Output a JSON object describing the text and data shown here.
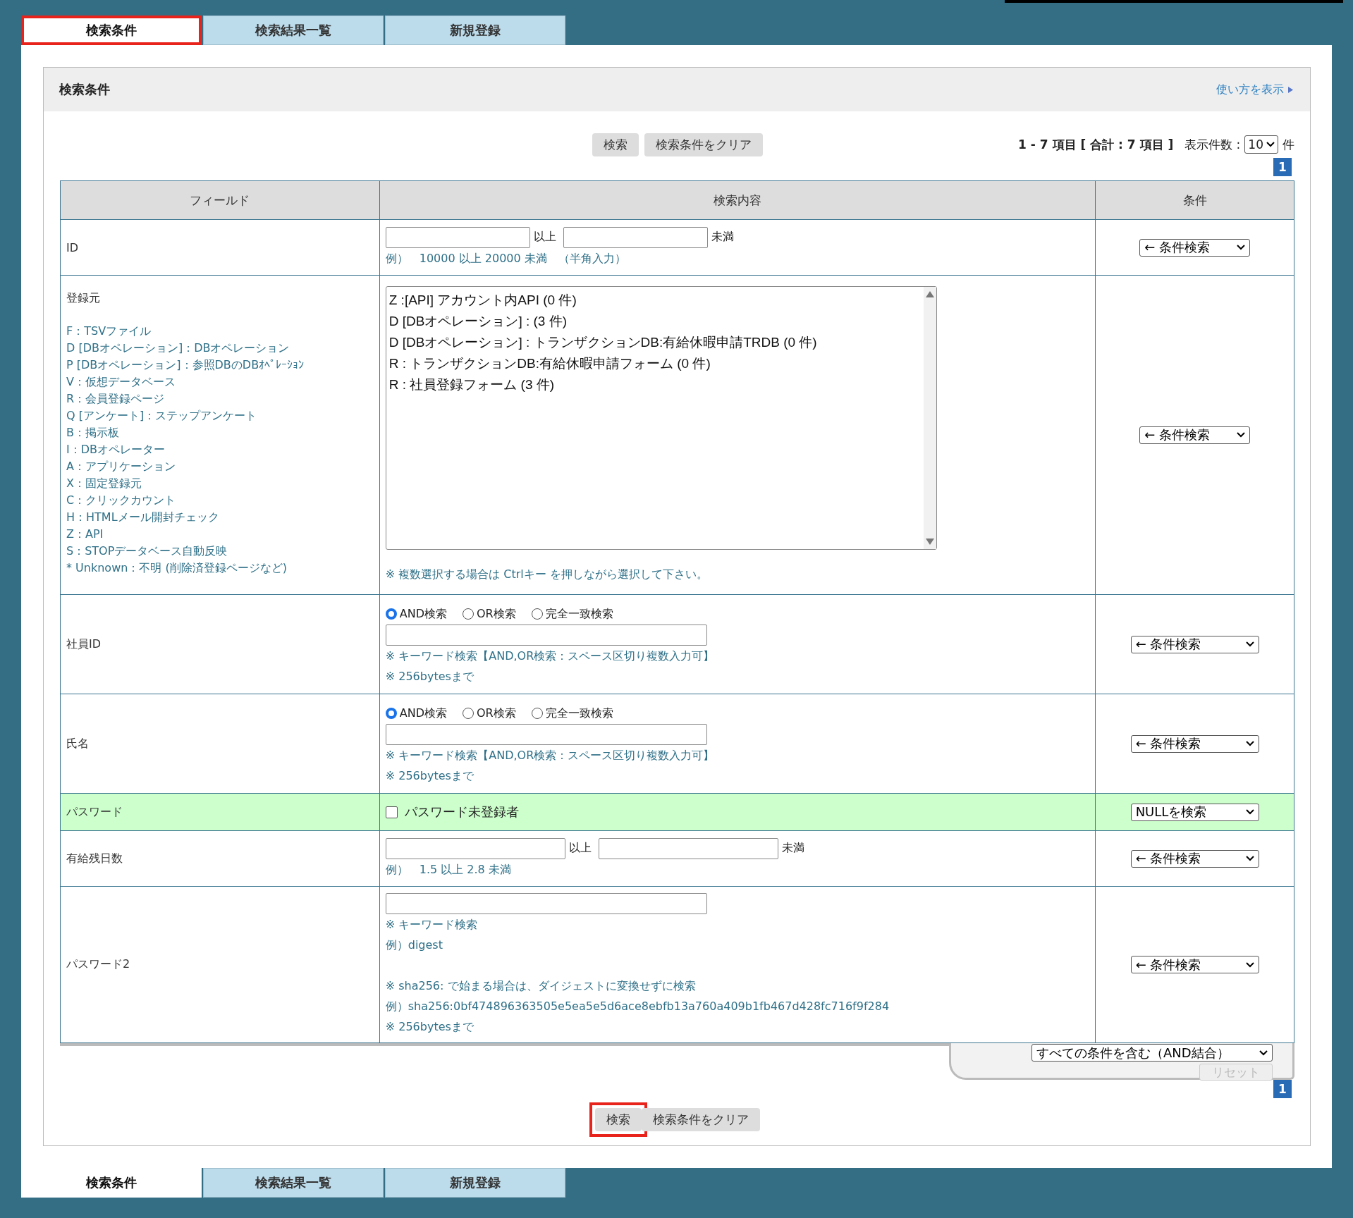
{
  "tabs_top": [
    {
      "label": "検索条件",
      "selected": true,
      "highlighted": true
    },
    {
      "label": "検索結果一覧",
      "selected": false,
      "highlighted": false
    },
    {
      "label": "新規登録",
      "selected": false,
      "highlighted": false
    }
  ],
  "panel": {
    "title": "検索条件",
    "help_link": "使い方を表示"
  },
  "toolbar": {
    "buttons": [
      {
        "label": "検索",
        "highlighted": false
      },
      {
        "label": "検索条件をクリア",
        "highlighted": false
      }
    ],
    "summary": "1 - 7 項目 [ 合計 : 7 項目 ]",
    "per_page_label": "表示件数 :",
    "per_page": "10",
    "per_page_unit": "件",
    "page": "1"
  },
  "table": {
    "columns": [
      "フィールド",
      "検索内容",
      "条件"
    ],
    "rows": [
      {
        "kind": "range",
        "field": "ID",
        "highlight": false,
        "from_suffix": "以上",
        "to_suffix": "未満",
        "hint": "例）　10000 以上 20000 未満　（半角入力）",
        "condition": "← 条件検索"
      },
      {
        "kind": "listbox",
        "field": "登録元",
        "highlight": false,
        "legend": [
          "F：TSVファイル",
          "D [DBオペレーション]：DBオペレーション",
          "P [DBオペレーション]：参照DBのDBｵﾍﾟﾚｰｼｮﾝ",
          "V：仮想データベース",
          "R：会員登録ページ",
          "Q [アンケート]：ステップアンケート",
          "B：掲示板",
          "I：DBオペレーター",
          "A：アプリケーション",
          "X：固定登録元",
          "C：クリックカウント",
          "H：HTMLメール開封チェック",
          "Z：API",
          "S：STOPデータベース自動反映",
          "* Unknown：不明 (削除済登録ページなど)"
        ],
        "options": [
          "Z :[API] アカウント内API (0 件)",
          "D [DBオペレーション] : (3 件)",
          "D [DBオペレーション] : トランザクションDB:有給休暇申請TRDB (0 件)",
          "R : トランザクションDB:有給休暇申請フォーム (0 件)",
          "R : 社員登録フォーム (3 件)"
        ],
        "note": "※ 複数選択する場合は Ctrlキー を押しながら選択して下さい。",
        "condition": "← 条件検索"
      },
      {
        "kind": "keyword",
        "field": "社員ID",
        "highlight": false,
        "radios": [
          {
            "label": "AND検索",
            "selected": true
          },
          {
            "label": "OR検索",
            "selected": false
          },
          {
            "label": "完全一致検索",
            "selected": false
          }
        ],
        "notes": [
          "※ キーワード検索【AND,OR検索：スペース区切り複数入力可】",
          "※ 256bytesまで"
        ],
        "condition": "← 条件検索"
      },
      {
        "kind": "keyword",
        "field": "氏名",
        "highlight": false,
        "radios": [
          {
            "label": "AND検索",
            "selected": true
          },
          {
            "label": "OR検索",
            "selected": false
          },
          {
            "label": "完全一致検索",
            "selected": false
          }
        ],
        "notes": [
          "※ キーワード検索【AND,OR検索：スペース区切り複数入力可】",
          "※ 256bytesまで"
        ],
        "condition": "← 条件検索"
      },
      {
        "kind": "checkbox",
        "field": "パスワード",
        "highlight": true,
        "checkbox": {
          "label": "パスワード未登録者",
          "checked": false
        },
        "condition": "NULLを検索"
      },
      {
        "kind": "range",
        "field": "有給残日数",
        "highlight": false,
        "from_suffix": "以上",
        "to_suffix": "未満",
        "hint": "例）　1.5 以上 2.8 未満",
        "condition": "← 条件検索"
      },
      {
        "kind": "text",
        "field": "パスワード2",
        "highlight": false,
        "notes": [
          "※ キーワード検索",
          "例）digest"
        ],
        "extra_notes": [
          "※ sha256: で始まる場合は、ダイジェストに変換せずに検索",
          "例）sha256:0bf474896363505e5ea5e5d6ace8ebfb13a760a409b1fb467d428fc716f9f284",
          "※ 256bytesまで"
        ],
        "condition": "← 条件検索"
      }
    ]
  },
  "footer": {
    "combine": "すべての条件を含む（AND結合）",
    "reset": {
      "label": "リセット",
      "disabled": true
    },
    "page": "1"
  },
  "bottom_buttons": [
    {
      "label": "検索",
      "highlighted": true
    },
    {
      "label": "検索条件をクリア",
      "highlighted": false
    }
  ],
  "tabs_bottom": [
    {
      "label": "検索条件",
      "selected": true,
      "highlighted": false
    },
    {
      "label": "検索結果一覧",
      "selected": false,
      "highlighted": false
    },
    {
      "label": "新規登録",
      "selected": false,
      "highlighted": false
    }
  ]
}
